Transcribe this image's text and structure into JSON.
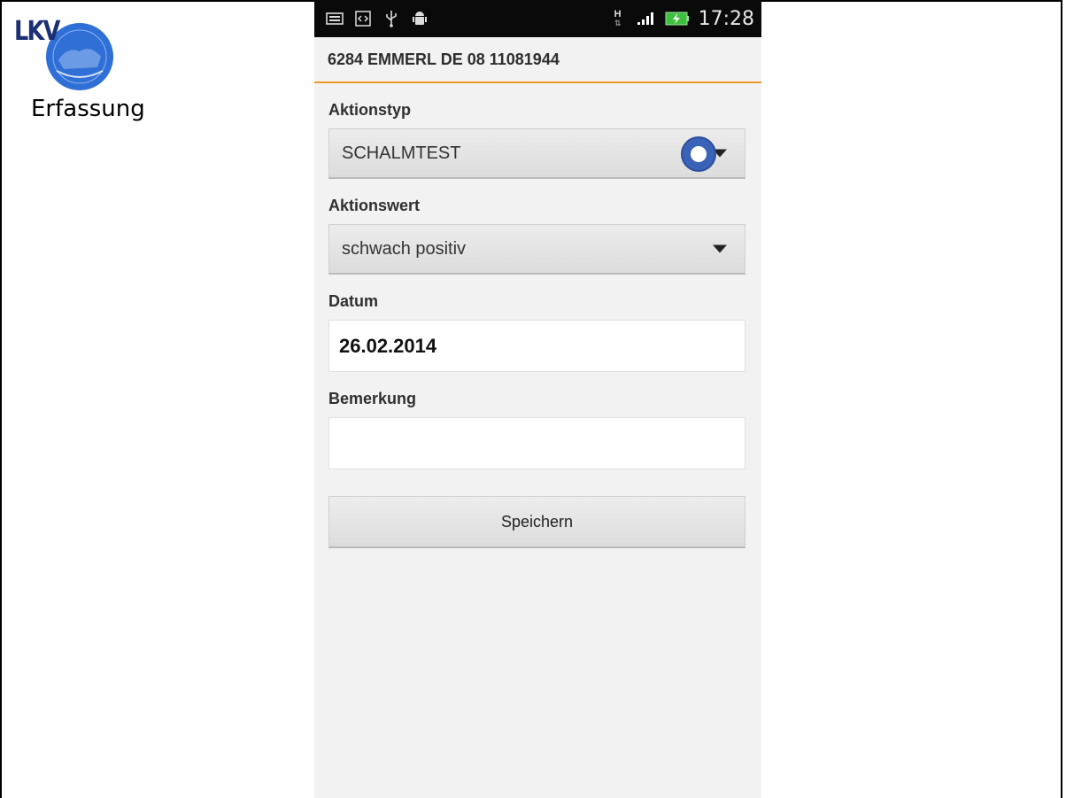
{
  "slide": {
    "caption": "Erfassung",
    "logo": {
      "text": "LKV",
      "alt": "LKV Baden-Württemberg"
    }
  },
  "status_bar": {
    "time": "17:28",
    "left_icons": [
      "keyboard-icon",
      "code-icon",
      "usb-icon",
      "android-debug-icon"
    ],
    "right_icons": [
      "network-h-icon",
      "signal-icon",
      "battery-charging-icon"
    ],
    "network_type": "H"
  },
  "app": {
    "header": {
      "title": "6284 EMMERL DE 08 11081944"
    },
    "form": {
      "aktionstyp": {
        "label": "Aktionstyp",
        "value": "SCHALMTEST"
      },
      "aktionswert": {
        "label": "Aktionswert",
        "value": "schwach positiv"
      },
      "datum": {
        "label": "Datum",
        "value": "26.02.2014"
      },
      "bemerkung": {
        "label": "Bemerkung",
        "value": "",
        "placeholder": ""
      }
    },
    "save_button": {
      "label": "Speichern"
    }
  },
  "colors": {
    "accent": "#ef9a2a",
    "status_bar_bg": "#0a0a0a",
    "background": "#f2f2f2",
    "touch_indicator": "#3a63b8"
  }
}
